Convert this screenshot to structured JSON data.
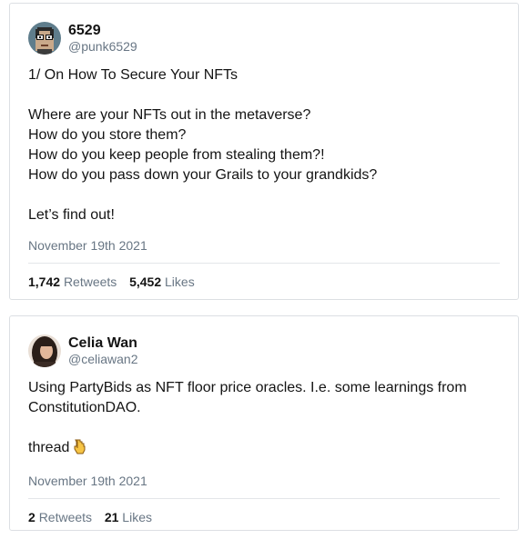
{
  "tweets": [
    {
      "display_name": "6529",
      "handle": "@punk6529",
      "lines": [
        "1/ On How To Secure Your NFTs",
        "",
        "Where are your NFTs out in the metaverse?",
        "How do you store them?",
        "How do you keep people from stealing them?!",
        "How do you pass down your Grails to your grandkids?",
        "",
        "Let’s find out!"
      ],
      "date": "November 19th 2021",
      "retweets_count": "1,742",
      "retweets_label": "Retweets",
      "likes_count": "5,452",
      "likes_label": "Likes",
      "avatar_icon": "punk-avatar-icon"
    },
    {
      "display_name": "Celia Wan",
      "handle": "@celiawan2",
      "lines": [
        "Using PartyBids as NFT floor price oracles. I.e. some learnings from",
        "ConstitutionDAO.",
        "",
        "thread"
      ],
      "emoji": "pointing-down-hand-icon",
      "date": "November 19th 2021",
      "retweets_count": "2",
      "retweets_label": "Retweets",
      "likes_count": "21",
      "likes_label": "Likes",
      "avatar_icon": "profile-photo-icon"
    }
  ]
}
